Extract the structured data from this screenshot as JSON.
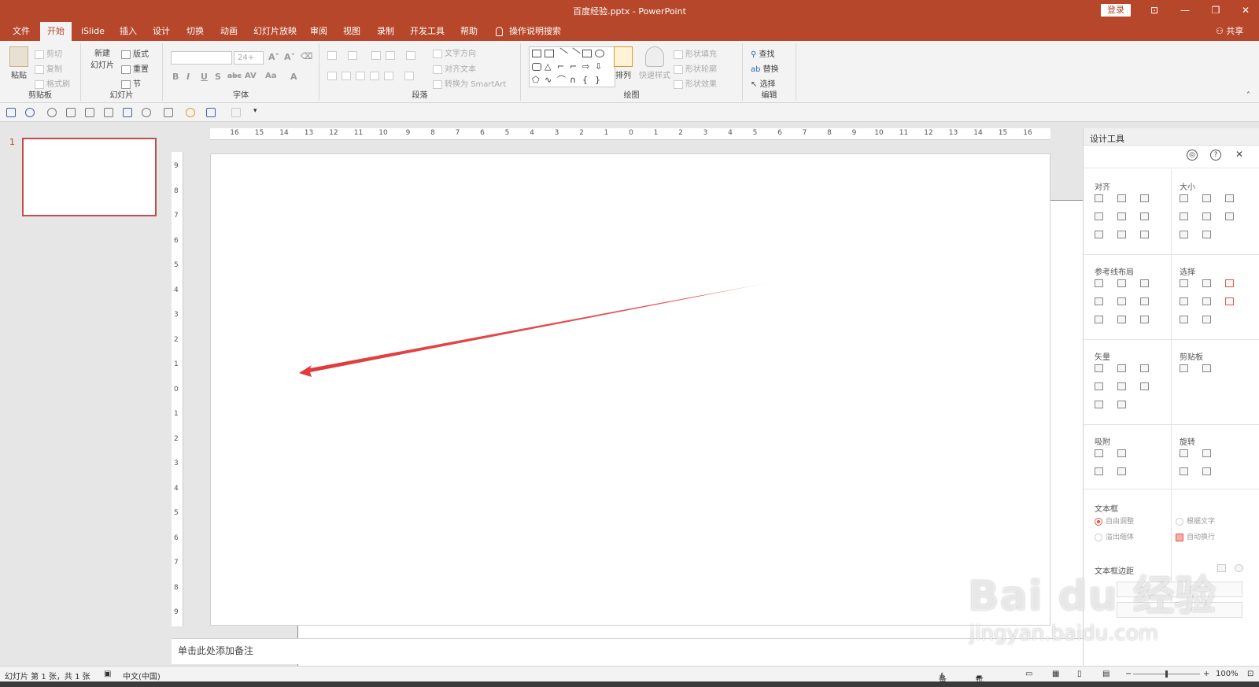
{
  "window": {
    "title": "百度经验.pptx  -  PowerPoint",
    "login": "登录",
    "controls": [
      "⊡",
      "—",
      "❐",
      "✕"
    ]
  },
  "tabs": [
    "文件",
    "开始",
    "iSlide",
    "插入",
    "设计",
    "切换",
    "动画",
    "幻灯片放映",
    "审阅",
    "视图",
    "录制",
    "开发工具",
    "帮助"
  ],
  "tell_me": "操作说明搜索",
  "share": "共享",
  "ribbon": {
    "clipboard": {
      "label": "剪贴板",
      "paste": "粘贴",
      "cut": "剪切",
      "copy": "复制",
      "painter": "格式刷"
    },
    "slides": {
      "label": "幻灯片",
      "new_line1": "新建",
      "new_line2": "幻灯片",
      "layout": "版式",
      "reset": "重置",
      "section": "节"
    },
    "font": {
      "label": "字体",
      "font_name": "",
      "font_size": "24+",
      "grow": "A˄",
      "shrink": "A˅",
      "bold": "B",
      "italic": "I",
      "underline": "U",
      "shadow": "S",
      "strike": "abc",
      "spacing": "AV",
      "case": "Aa",
      "color": "A"
    },
    "paragraph": {
      "label": "段落",
      "text_dir": "文字方向",
      "align_text": "对齐文本",
      "smartart": "转换为 SmartArt"
    },
    "drawing": {
      "label": "绘图",
      "arrange": "排列",
      "quick_styles": "快速样式",
      "fill": "形状填充",
      "outline": "形状轮廓",
      "effects": "形状效果"
    },
    "editing": {
      "label": "编辑",
      "find": "查找",
      "replace": "替换",
      "select": "选择"
    }
  },
  "slides_panel": {
    "slide_number": "1"
  },
  "ruler": {
    "h_labels": [
      "16",
      "15",
      "14",
      "13",
      "12",
      "11",
      "10",
      "9",
      "8",
      "7",
      "6",
      "5",
      "4",
      "3",
      "2",
      "1",
      "0",
      "1",
      "2",
      "3",
      "4",
      "5",
      "6",
      "7",
      "8",
      "9",
      "10",
      "11",
      "12",
      "13",
      "14",
      "15",
      "16"
    ],
    "v_labels": [
      "9",
      "8",
      "7",
      "6",
      "5",
      "4",
      "3",
      "2",
      "1",
      "0",
      "1",
      "2",
      "3",
      "4",
      "5",
      "6",
      "7",
      "8",
      "9"
    ]
  },
  "notes_placeholder": "单击此处添加备注",
  "design_tools": {
    "title": "设计工具",
    "sections": {
      "align": "对齐",
      "size": "大小",
      "guides": "参考线布局",
      "select": "选择",
      "vector": "矢量",
      "clipboard": "剪贴板",
      "snap": "吸附",
      "rotate": "旋转",
      "textbox": "文本框",
      "margins": "文本框边距"
    },
    "textbox_options": [
      "自由调整",
      "根据文字",
      "溢出缩体",
      "自动换行"
    ]
  },
  "watermark": {
    "main": "Bai du 经验",
    "sub": "jingyan.baidu.com"
  },
  "status": {
    "slide_info": "幻灯片 第 1 张，共 1 张",
    "language": "中文(中国)",
    "notes": "备注",
    "comments": "批注",
    "zoom": "100%"
  },
  "colors": {
    "accent": "#b7472a",
    "arrow": "#e0393a"
  }
}
